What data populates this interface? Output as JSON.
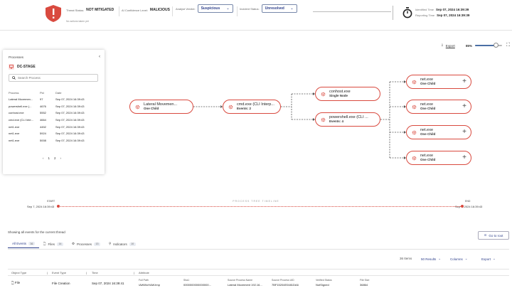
{
  "header": {
    "threat_status_label": "Threat Status:",
    "threat_status_value": "NOT MITIGATED",
    "ai_confidence_label": "AI Confidence Level:",
    "ai_confidence_value": "MALICIOUS",
    "analyst_verdict_label": "Analyst Verdict:",
    "analyst_verdict_value": "Suspicious",
    "incident_status_label": "Incident Status:",
    "incident_status_value": "Unresolved",
    "no_actions": "No actions taken yet",
    "identified_label": "Identified Time",
    "identified_value": "Sep 07, 2024 16:39:39",
    "reporting_label": "Reporting Time",
    "reporting_value": "Sep 07, 2024 16:39:39"
  },
  "canvas": {
    "export_label": "Export",
    "zoom_label": "85%",
    "zoom_level": 0.85
  },
  "processes": {
    "title": "Processes",
    "host": "DC-STAGE",
    "search_placeholder": "Search Process",
    "columns": [
      "Process",
      "Pid",
      "Date"
    ],
    "rows": [
      {
        "process": "Lateral Movemen...",
        "pid": "97",
        "date": "Sep 07, 2024 16:39:43"
      },
      {
        "process": "powershell.exe (...",
        "pid": "4676",
        "date": "Sep 07, 2024 16:39:43"
      },
      {
        "process": "conhost.exe",
        "pid": "5552",
        "date": "Sep 07, 2024 16:39:43"
      },
      {
        "process": "cmd.exe (CLI Inte...",
        "pid": "4664",
        "date": "Sep 07, 2024 16:39:43"
      },
      {
        "process": "net1.exe",
        "pid": "4452",
        "date": "Sep 07, 2024 16:39:43"
      },
      {
        "process": "net1.exe",
        "pid": "5924",
        "date": "Sep 07, 2024 16:39:43"
      },
      {
        "process": "net1.exe",
        "pid": "5008",
        "date": "Sep 07, 2024 16:39:43"
      }
    ],
    "pager": [
      "‹",
      "1",
      "2",
      "›"
    ]
  },
  "graph": {
    "nodes": [
      {
        "title": "Lateral Movemen...",
        "subtitle": "One Child"
      },
      {
        "title": "cmd.exe (CLI Interp...",
        "subtitle": "Events: 2"
      },
      {
        "title": "conhost.exe",
        "subtitle": "Single Node"
      },
      {
        "title": "powershell.exe (CLI ...",
        "subtitle": "Events: 4"
      },
      {
        "title": "net.exe",
        "subtitle": "One Child"
      },
      {
        "title": "net.exe",
        "subtitle": "One Child"
      },
      {
        "title": "net.exe",
        "subtitle": "One Child"
      },
      {
        "title": "net.exe",
        "subtitle": "One Child"
      }
    ]
  },
  "timeline": {
    "label": "PROCESS TREE TIMELINE",
    "start_label": "START",
    "end_label": "END",
    "start_date": "Sep 7, 2024 16:39:43",
    "end_date": "Sep 7, 2024 16:39:43"
  },
  "events": {
    "overlay_text": "Showing all events for the current thread",
    "go_to_root": "Go to root",
    "tabs": [
      {
        "label": "All Events",
        "count": "36"
      },
      {
        "label": "Files",
        "count": "14"
      },
      {
        "label": "Processes",
        "count": "13"
      },
      {
        "label": "Indicators",
        "count": "10"
      }
    ],
    "items_count": "36 Items",
    "results_label": "50 Results",
    "columns_label": "Columns",
    "export_label": "Export",
    "grid_columns": [
      "Object Type",
      "Event Type",
      "Time",
      "Attribute"
    ],
    "row": {
      "object_type": "File",
      "event_type": "File Creation",
      "time": "Sep 07, 2024 16:39:41",
      "attrs": [
        {
          "label": "Full Path",
          "value": "\\AWWcHAW.tmp"
        },
        {
          "label": "Sha1",
          "value": "0000000000000000..."
        },
        {
          "label": "Source Process Name",
          "value": "Lateral Movement 192.16..."
        },
        {
          "label": "Source Process UID",
          "value": "7BF15204E0481DA6"
        },
        {
          "label": "Verified Status",
          "value": "NotSigned"
        },
        {
          "label": "File Size",
          "value": "36864"
        }
      ]
    }
  },
  "colors": {
    "accent": "#d94a3f",
    "brand_blue": "#2c3e8a"
  }
}
